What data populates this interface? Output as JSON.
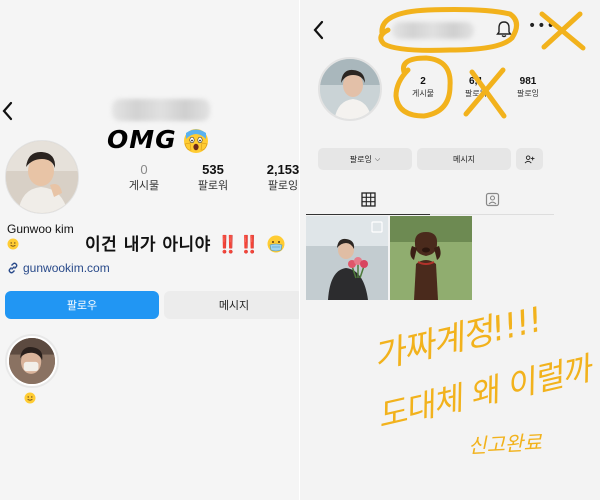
{
  "left": {
    "headline": "OMG",
    "headline_emoji": "screaming-face",
    "avatar": "profile-photo-man",
    "stats": [
      {
        "value": "0",
        "label": "게시물"
      },
      {
        "value": "535",
        "label": "팔로워"
      },
      {
        "value": "2,153",
        "label": "팔로잉"
      }
    ],
    "name": "Gunwoo kim",
    "bio_text": "이건 내가 아니야",
    "bio_marks": "‼️‼️",
    "bio_emoji": "mask-face",
    "link": "gunwookim.com",
    "follow_label": "팔로우",
    "message_label": "메시지",
    "highlight_emoji": "smiley-face"
  },
  "right": {
    "avatar": "profile-photo-woman",
    "stats": [
      {
        "value": "2",
        "label": "게시물"
      },
      {
        "value": "6,1",
        "label": "팔로워"
      },
      {
        "value": "981",
        "label": "팔로잉"
      }
    ],
    "following_label": "팔로잉",
    "message_label": "메시지",
    "annotations": {
      "line1": "가짜계정!!!!",
      "line2": "도대체 왜 이럴까",
      "line3": "신고완료"
    }
  },
  "colors": {
    "follow_blue": "#2196f3",
    "annotation_yellow": "#f2b21c",
    "alert_red": "#e0212b"
  }
}
